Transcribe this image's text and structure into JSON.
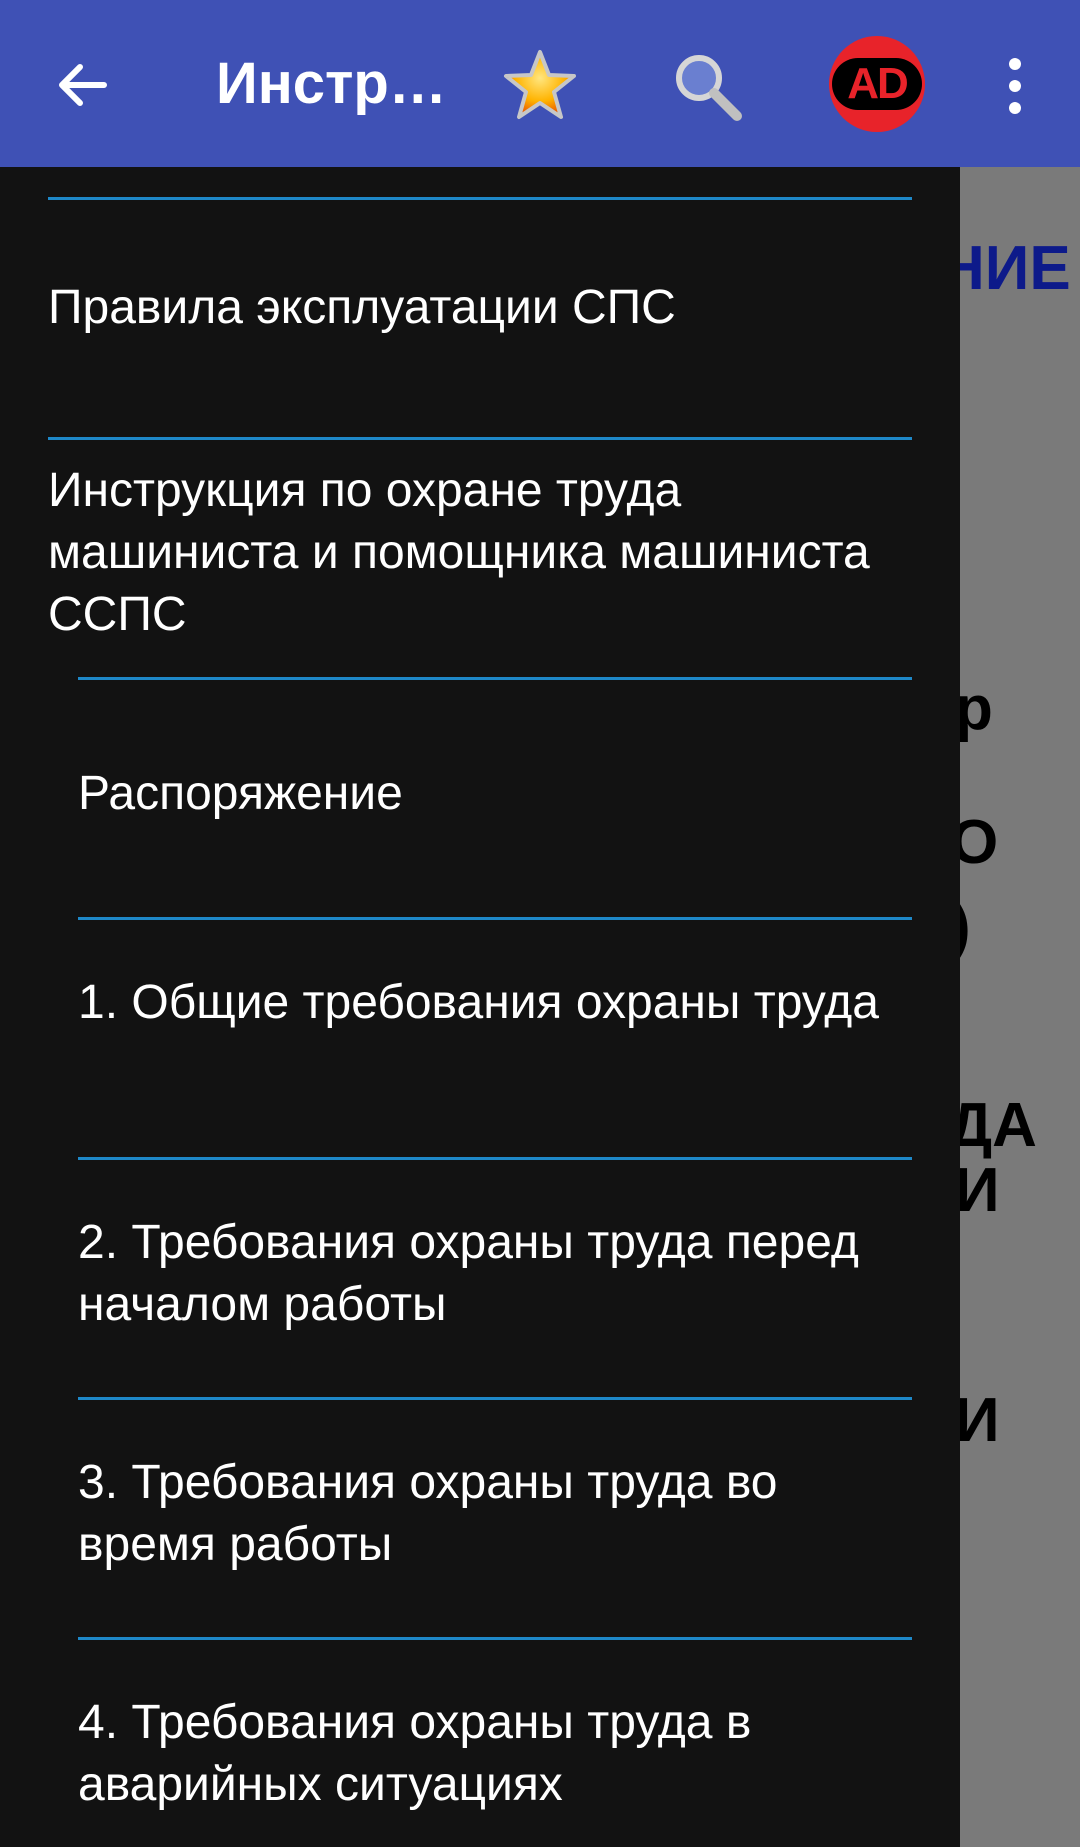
{
  "toolbar": {
    "title": "Инстр…",
    "back_icon": "arrow-left-icon",
    "favorite_icon": "star-icon",
    "search_icon": "search-icon",
    "ad_label": "AD",
    "more_icon": "more-vertical-icon"
  },
  "drawer": {
    "items": [
      {
        "label": "Правила эксплуатации СПС"
      },
      {
        "label": "Инструкция по охране труда машиниста и помощника машиниста ССПС"
      },
      {
        "label": "Распоряжение"
      },
      {
        "label": "1. Общие требования охраны труда"
      },
      {
        "label": "2. Требования охраны труда перед началом работы"
      },
      {
        "label": "3. Требования охраны труда во время работы"
      },
      {
        "label": "4. Требования охраны труда в аварийных ситуациях"
      }
    ]
  },
  "background": {
    "fragments": [
      "НИЕ",
      "р",
      "О",
      ")",
      "ДА",
      "И",
      "И"
    ]
  },
  "colors": {
    "toolbar": "#3f51b5",
    "drawer": "#121212",
    "divider": "#1e88c8",
    "scrim": "#7a7a7a"
  }
}
